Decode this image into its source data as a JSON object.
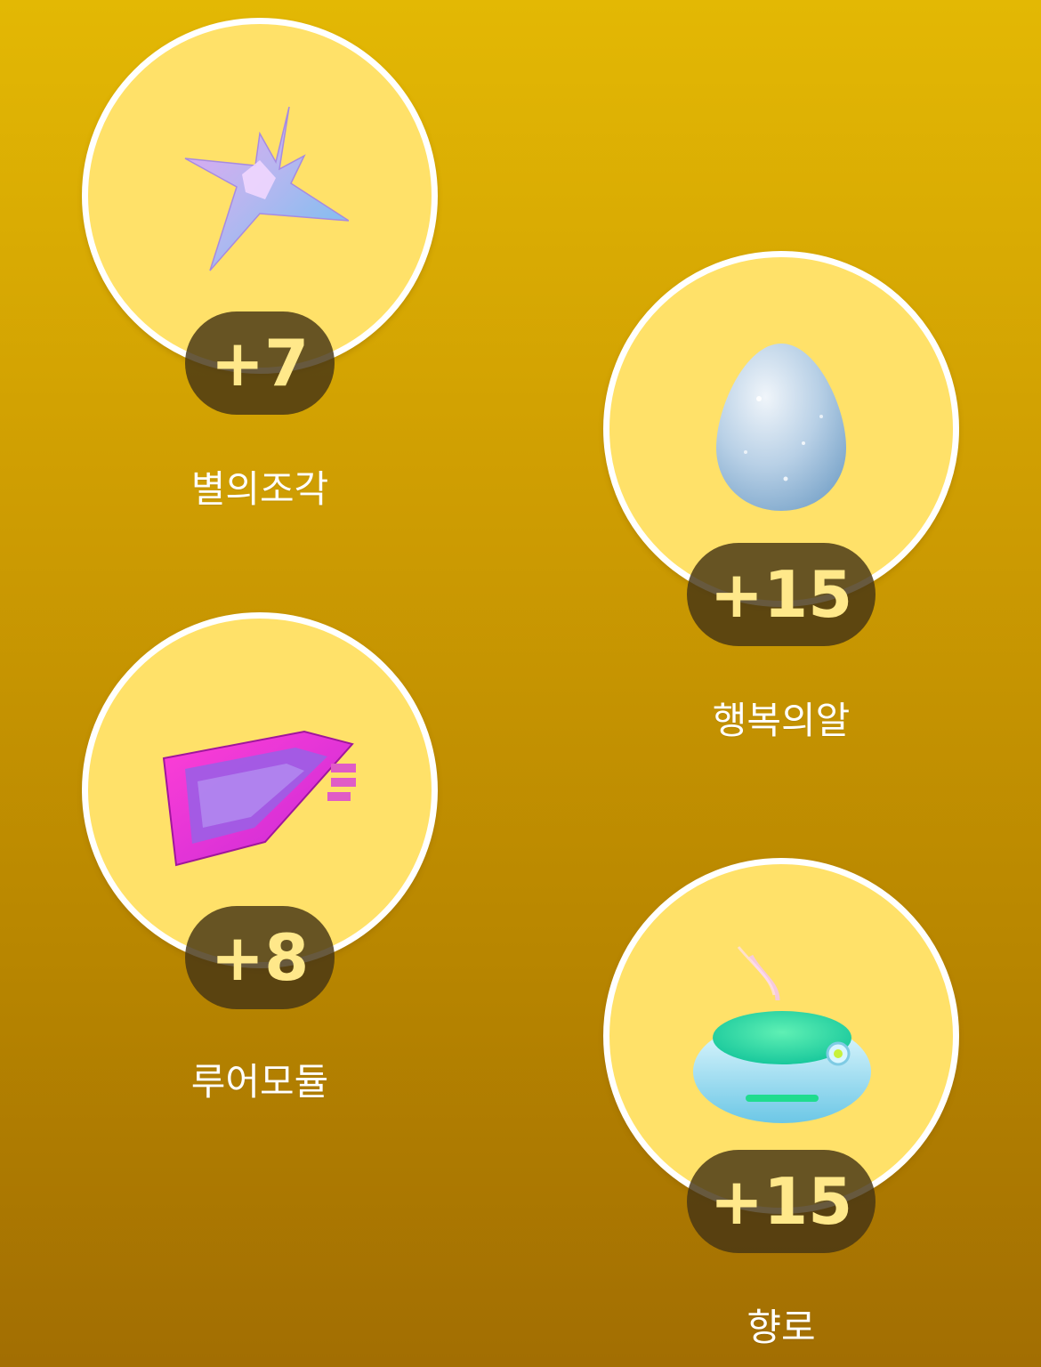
{
  "rewards": [
    {
      "name": "별의조각",
      "count": "+7",
      "icon": "stardust-shard-icon"
    },
    {
      "name": "행복의알",
      "count": "+15",
      "icon": "lucky-egg-icon"
    },
    {
      "name": "루어모듈",
      "count": "+8",
      "icon": "lure-module-icon"
    },
    {
      "name": "향로",
      "count": "+15",
      "icon": "incense-icon"
    }
  ],
  "colors": {
    "circle_fill": "#ffe169",
    "circle_border": "#ffffff",
    "badge_bg": "#463414",
    "badge_text": "#ffe88a",
    "label_text": "#ffffff"
  }
}
